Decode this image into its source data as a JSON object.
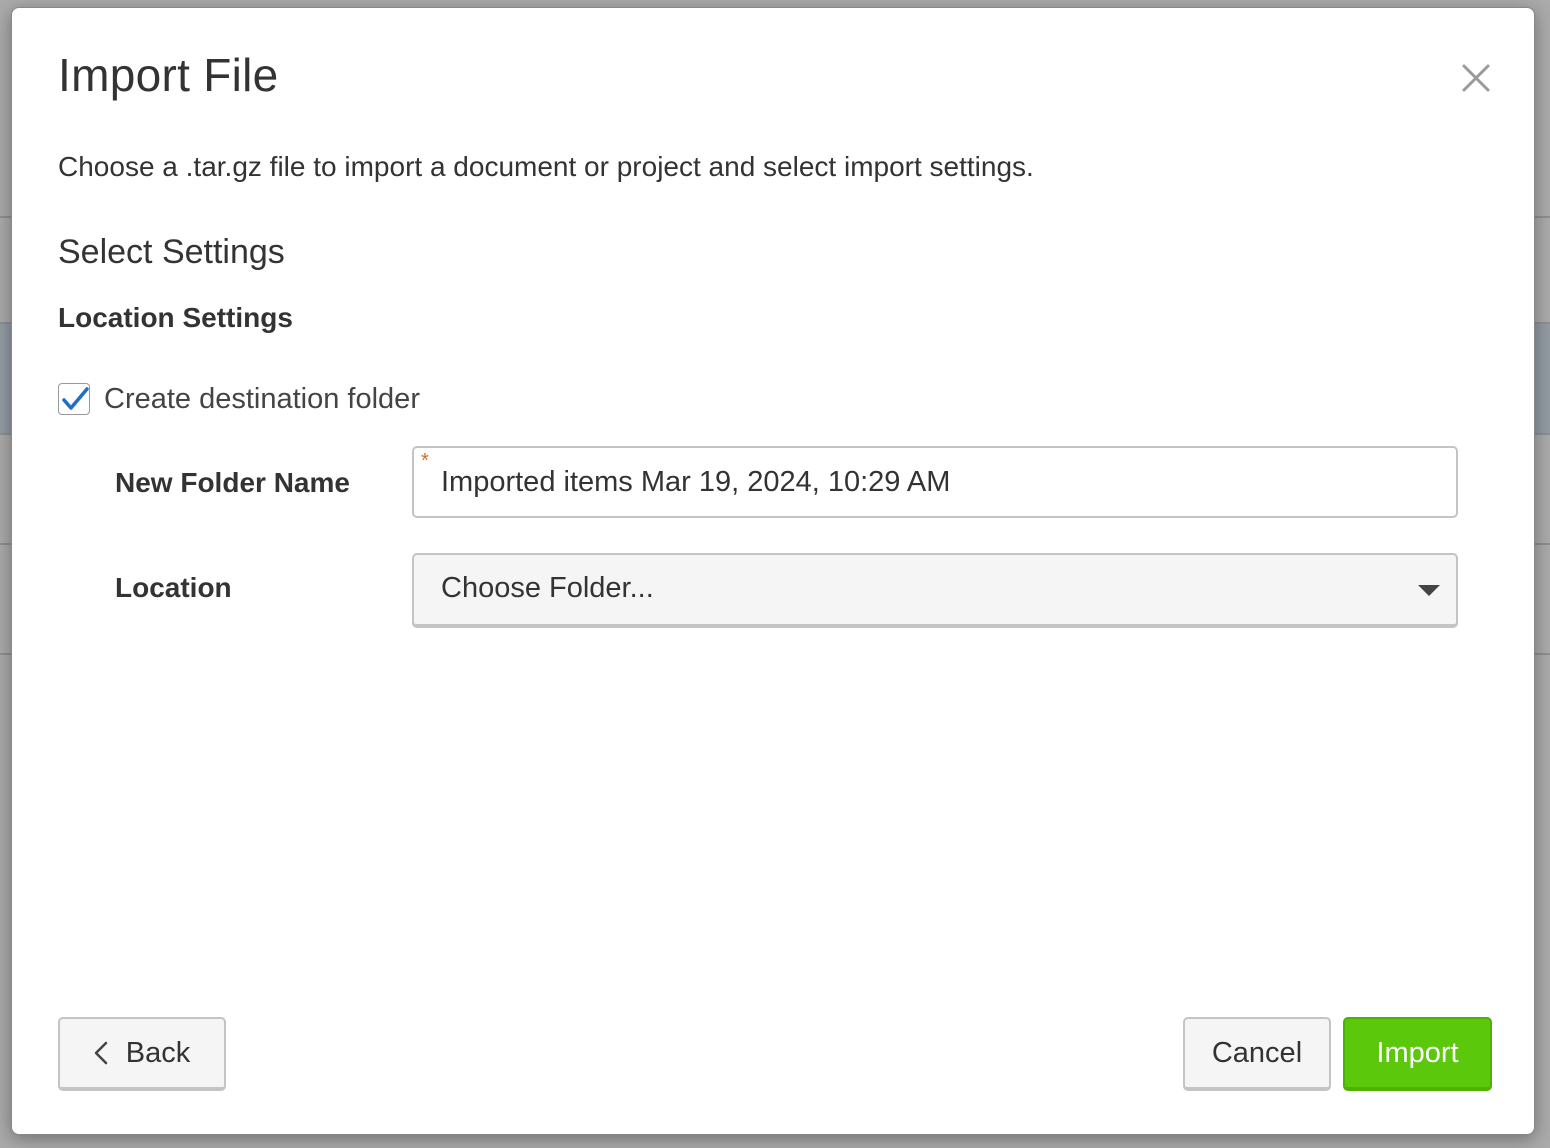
{
  "dialog": {
    "title": "Import File",
    "description": "Choose a .tar.gz file to import a document or project and select import settings.",
    "section_title": "Select Settings",
    "subsection_title": "Location Settings",
    "create_folder": {
      "label": "Create destination folder",
      "checked": true
    },
    "new_folder_name": {
      "label": "New Folder Name",
      "value": "Imported items Mar 19, 2024, 10:29 AM",
      "required": true
    },
    "location": {
      "label": "Location",
      "selected": "Choose Folder..."
    },
    "buttons": {
      "back": "Back",
      "cancel": "Cancel",
      "import": "Import"
    }
  },
  "colors": {
    "primary_button": "#5bc80b",
    "checkmark": "#1f6fc5",
    "required_star": "#e06a1d"
  },
  "icons": {
    "close": "close-icon",
    "check": "checkmark-icon",
    "dropdown": "caret-down-icon",
    "back": "chevron-left-icon"
  }
}
